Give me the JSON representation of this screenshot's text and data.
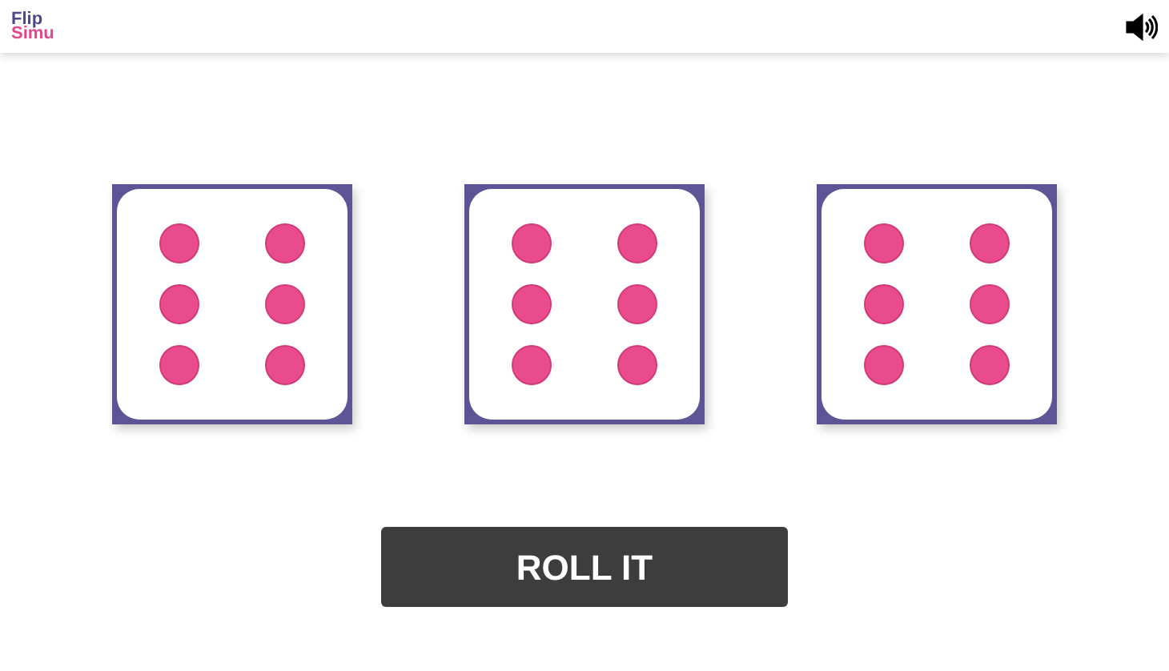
{
  "header": {
    "logo": {
      "line_1": "Flip",
      "line_2": "Simu"
    }
  },
  "dice": [
    {
      "kind": "six"
    },
    {
      "kind": "six"
    },
    {
      "kind": "six"
    }
  ],
  "roll_button": {
    "label": "ROLL IT"
  }
}
